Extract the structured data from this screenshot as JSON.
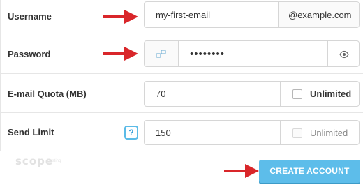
{
  "form": {
    "username": {
      "label": "Username",
      "value": "my-first-email",
      "domain_addon": "@example.com"
    },
    "password": {
      "label": "Password",
      "generator_icon": "key-generator-icon",
      "value": "••••••••",
      "toggle_icon": "eye-icon"
    },
    "quota": {
      "label": "E-mail Quota (MB)",
      "value": "70",
      "unlimited_label": "Unlimited",
      "unlimited_checked": false
    },
    "send_limit": {
      "label": "Send Limit",
      "help_glyph": "?",
      "value": "150",
      "unlimited_label": "Unlimited",
      "unlimited_checked": false,
      "unlimited_disabled": true
    },
    "submit_label": "CREATE ACCOUNT"
  },
  "watermark": {
    "brand": "scope",
    "sub": "hosting"
  },
  "colors": {
    "accent_button": "#5dbdea",
    "annotation_arrow": "#d9262a",
    "help_border": "#5bbbe7"
  }
}
